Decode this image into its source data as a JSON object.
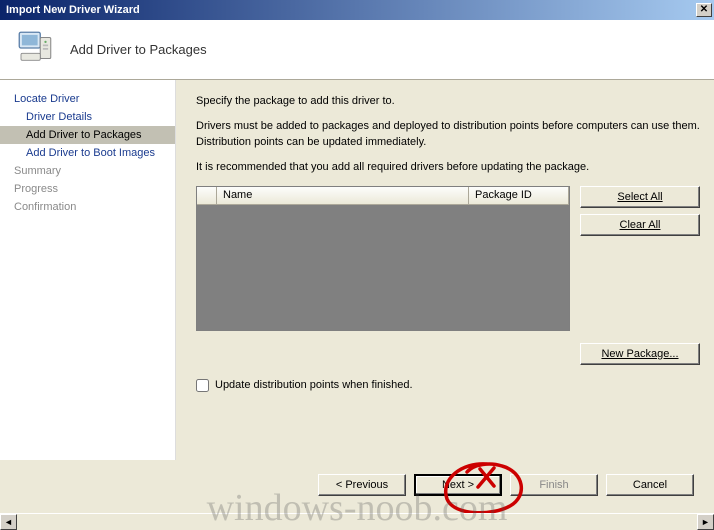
{
  "window": {
    "title": "Import New Driver Wizard"
  },
  "header": {
    "title": "Add Driver to Packages"
  },
  "nav": {
    "items": [
      {
        "label": "Locate Driver",
        "sub": false,
        "active": false,
        "muted": false
      },
      {
        "label": "Driver Details",
        "sub": true,
        "active": false,
        "muted": false
      },
      {
        "label": "Add Driver to Packages",
        "sub": true,
        "active": true,
        "muted": false
      },
      {
        "label": "Add Driver to Boot Images",
        "sub": true,
        "active": false,
        "muted": false
      },
      {
        "label": "Summary",
        "sub": false,
        "active": false,
        "muted": true
      },
      {
        "label": "Progress",
        "sub": false,
        "active": false,
        "muted": true
      },
      {
        "label": "Confirmation",
        "sub": false,
        "active": false,
        "muted": true
      }
    ]
  },
  "content": {
    "line1": "Specify the package to add this driver to.",
    "line2": "Drivers must be added to packages and deployed to distribution points before computers can use them.  Distribution points can be updated immediately.",
    "line3": "It is recommended that you add all required drivers before updating the package.",
    "columns": {
      "name": "Name",
      "pkg": "Package ID"
    },
    "buttons": {
      "select_all": "Select All",
      "clear_all": "Clear All",
      "new_package": "New Package..."
    },
    "checkbox_label": "Update distribution points when finished.",
    "checkbox_checked": false
  },
  "footer": {
    "previous": "< Previous",
    "next": "Next >",
    "finish": "Finish",
    "cancel": "Cancel"
  },
  "watermark": "windows-noob.com"
}
